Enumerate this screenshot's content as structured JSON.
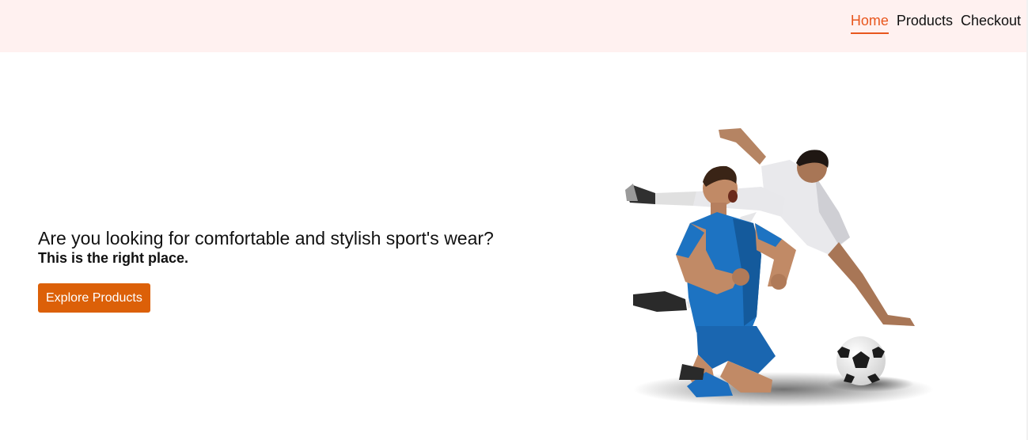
{
  "nav": {
    "items": [
      {
        "label": "Home",
        "active": true
      },
      {
        "label": "Products",
        "active": false
      },
      {
        "label": "Checkout",
        "active": false
      }
    ]
  },
  "hero": {
    "headline": "Are you looking for comfortable and stylish sport's wear?",
    "subline": "This is the right place.",
    "cta_label": "Explore Products"
  },
  "colors": {
    "accent": "#e8571e",
    "button": "#dc6008",
    "header_bg": "#fff1f0"
  }
}
